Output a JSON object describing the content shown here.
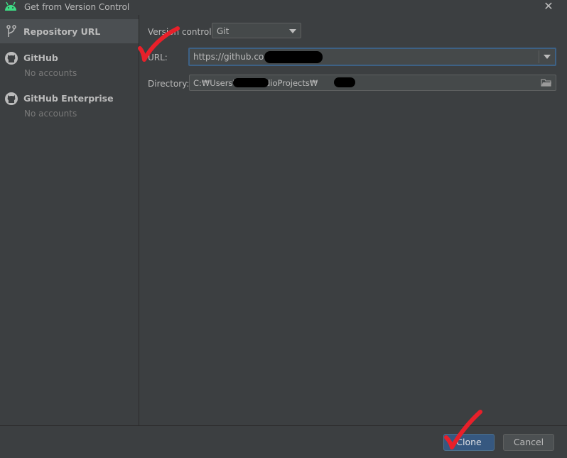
{
  "window": {
    "title": "Get from Version Control"
  },
  "sidebar": {
    "items": [
      {
        "label": "Repository URL",
        "sub": ""
      },
      {
        "label": "GitHub",
        "sub": "No accounts"
      },
      {
        "label": "GitHub Enterprise",
        "sub": "No accounts"
      }
    ]
  },
  "form": {
    "version_control_label": "Version control:",
    "version_control_value": "Git",
    "url_label": "URL:",
    "url_value": "https://github.com/                          .git",
    "directory_label": "Directory:",
    "directory_value": "C:₩Users₩                 ₩StudioProjects₩"
  },
  "buttons": {
    "clone": "Clone",
    "cancel": "Cancel"
  },
  "colors": {
    "accent": "#365880",
    "background": "#3c3f41",
    "annotation": "#e8202a",
    "android": "#3ddc84"
  }
}
